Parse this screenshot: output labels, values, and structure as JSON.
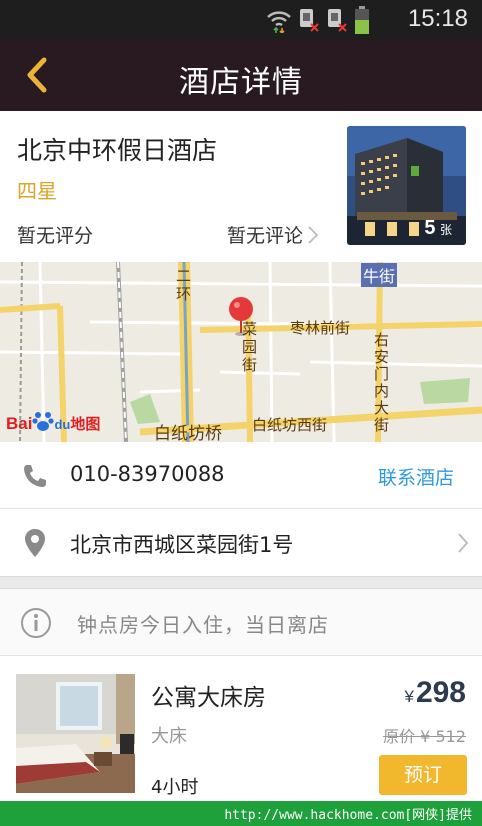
{
  "status_bar": {
    "time": "15:18",
    "icons": [
      "wifi-icon",
      "sim-no-signal-icon",
      "sim-no-signal-icon",
      "battery-icon"
    ]
  },
  "header": {
    "title": "酒店详情",
    "back_icon": "chevron-left-icon"
  },
  "hotel": {
    "name": "北京中环假日酒店",
    "star": "四星",
    "score": "暂无评分",
    "reviews": "暂无评论",
    "photo_count": "5",
    "photo_unit": "张"
  },
  "map": {
    "labels": {
      "niujie": "牛街",
      "erhuan": "二环",
      "zaolin": "枣林前街",
      "caiyuan": "菜园街",
      "youanmen": "右安门内大街",
      "baizhifangqiao": "白纸坊桥",
      "baizhifangxijie": "白纸坊西街"
    },
    "logo_bai": "Bai",
    "logo_du": "du",
    "logo_ditu": "地图"
  },
  "contact": {
    "phone": "010-83970088",
    "contact_button": "联系酒店",
    "address": "北京市西城区菜园街1号"
  },
  "notice": {
    "text": "钟点房今日入住，当日离店"
  },
  "room": {
    "name": "公寓大床房",
    "bed": "大床",
    "duration": "4小时",
    "currency": "¥",
    "price": "298",
    "original_price": "原价 ¥ 512",
    "book_button": "预订"
  },
  "watermark": "http://www.hackhome.com[网侠]提供",
  "colors": {
    "header_bg": "#291a22",
    "accent_gold": "#d9a629",
    "link_blue": "#2c9be0",
    "book_button": "#f1b82e",
    "price_text": "#2c3b4f"
  }
}
